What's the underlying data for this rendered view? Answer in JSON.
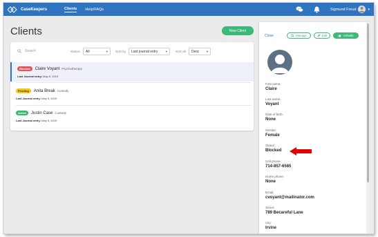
{
  "nav": {
    "brand": "CaseKeepers",
    "links": [
      "Clients",
      "Help/FAQs"
    ],
    "user_name": "Sigmund Freud",
    "colors": {
      "nav_bg": "#2f74c0",
      "accent": "#3cb878"
    }
  },
  "page": {
    "title": "Clients",
    "new_button": "New Client"
  },
  "filters": {
    "search_placeholder": "Search",
    "status_label": "Status",
    "status_value": "All",
    "sortby_label": "Sort by",
    "sortby_value": "Last journal entry",
    "sortdir_label": "Sort dir",
    "sortdir_value": "Desc"
  },
  "clients": [
    {
      "status": "Blocked",
      "name": "Claire Voyant",
      "type": "Psychotherapy",
      "journal_label": "Last Journal entry:",
      "journal_date": "May 5, 2019",
      "selected": true
    },
    {
      "status": "Pending",
      "name": "Anita Break",
      "type": "Custody",
      "journal_label": "Last Journal entry:",
      "journal_date": "May 5, 2019",
      "selected": false
    },
    {
      "status": "Active",
      "name": "Justin Case",
      "type": "Custody",
      "journal_label": "Last Journal entry:",
      "journal_date": "May 5, 2019",
      "selected": false
    }
  ],
  "detail": {
    "close": "Close",
    "manage": "Manage",
    "edit": "Edit",
    "activate": "Activate",
    "fields": [
      {
        "label": "First name:",
        "value": "Claire"
      },
      {
        "label": "Last name:",
        "value": "Voyant"
      },
      {
        "label": "Date of birth:",
        "value": "None"
      },
      {
        "label": "Gender:",
        "value": "Female"
      },
      {
        "label": "Status:",
        "value": "Blocked"
      },
      {
        "label": "Cell phone:",
        "value": "714-857-6565"
      },
      {
        "label": "Home phone:",
        "value": "None"
      },
      {
        "label": "Email:",
        "value": "cvoyant@mailinator.com"
      },
      {
        "label": "Street:",
        "value": "789 Becareful Lane"
      },
      {
        "label": "City:",
        "value": "Irvine"
      }
    ]
  }
}
